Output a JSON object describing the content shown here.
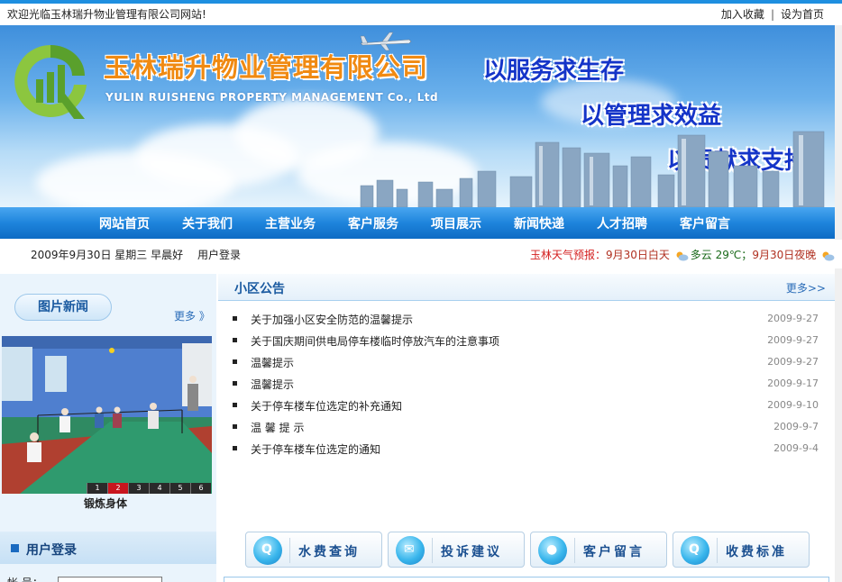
{
  "topbar": {
    "welcome": "欢迎光临玉林瑞升物业管理有限公司网站!",
    "bookmark": "加入收藏",
    "separator": "|",
    "homepage": "设为首页"
  },
  "banner": {
    "company_cn": "玉林瑞升物业管理有限公司",
    "company_en": "YULIN RUISHENG PROPERTY MANAGEMENT Co., Ltd",
    "slogans": [
      "以服务求生存",
      "以管理求效益",
      "以贡献求支持"
    ]
  },
  "nav": {
    "items": [
      "网站首页",
      "关于我们",
      "主营业务",
      "客户服务",
      "项目展示",
      "新闻快递",
      "人才招聘",
      "客户留言"
    ]
  },
  "infobar": {
    "date": "2009年9月30日  星期三  早晨好",
    "login_link": "用户登录",
    "weather_label": "玉林天气预报：",
    "weather_day": "9月30日白天",
    "weather_day_cond": "多云  29℃；",
    "weather_night": "9月30日夜晚"
  },
  "left": {
    "pic_news_title": "图片新闻",
    "pic_more": "更多 》",
    "photo_numbers": [
      "1",
      "2",
      "3",
      "4",
      "5",
      "6"
    ],
    "photo_active": "2",
    "photo_caption": "锻炼身体",
    "login_title": "用户登录",
    "login_field_label": "帐  号："
  },
  "notice": {
    "title": "小区公告",
    "more": "更多>>",
    "items": [
      {
        "title": "关于加强小区安全防范的温馨提示",
        "date": "2009-9-27"
      },
      {
        "title": "关于国庆期间供电局停车楼临时停放汽车的注意事项",
        "date": "2009-9-27"
      },
      {
        "title": "温馨提示",
        "date": "2009-9-27"
      },
      {
        "title": "温馨提示",
        "date": "2009-9-17"
      },
      {
        "title": "关于停车楼车位选定的补充通知",
        "date": "2009-9-10"
      },
      {
        "title": "温  馨  提  示",
        "date": "2009-9-7"
      },
      {
        "title": "关于停车楼车位选定的通知",
        "date": "2009-9-4"
      }
    ]
  },
  "quick_buttons": [
    {
      "label": "水费查询",
      "icon": "water-bill-icon",
      "glyph": "Q"
    },
    {
      "label": "投诉建议",
      "icon": "complaint-mail-icon",
      "glyph": "✉"
    },
    {
      "label": "客户留言",
      "icon": "customer-message-icon",
      "glyph": "●"
    },
    {
      "label": "收费标准",
      "icon": "fee-standard-icon",
      "glyph": "Q"
    }
  ],
  "colors": {
    "brand_blue": "#1e84dc",
    "logo_orange": "#f08a12",
    "slogan_blue": "#1434c8",
    "weather_red": "#d42020"
  }
}
